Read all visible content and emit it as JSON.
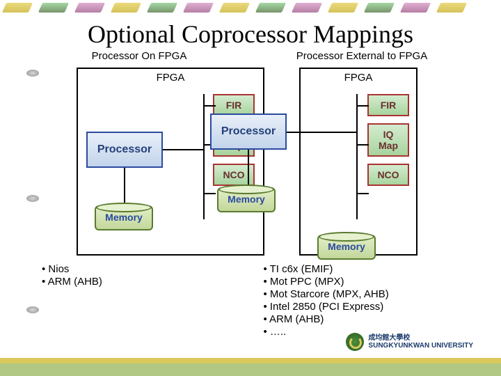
{
  "title": "Optional Coprocessor Mappings",
  "subtitles": {
    "left": "Processor On FPGA",
    "right": "Processor External to FPGA"
  },
  "fpga_label": "FPGA",
  "blocks": {
    "fir": "FIR",
    "iqmap": "IQ\nMap",
    "nco": "NCO",
    "processor": "Processor",
    "memory": "Memory"
  },
  "bullets_left": [
    "• Nios",
    "• ARM (AHB)"
  ],
  "bullets_right": [
    "• TI c6x (EMIF)",
    "• Mot PPC (MPX)",
    "• Mot Starcore (MPX, AHB)",
    "• Intel 2850 (PCI Express)",
    "• ARM (AHB)",
    "• ….."
  ],
  "logo": {
    "line1": "成均館大學校",
    "line2": "SUNGKYUNKWAN UNIVERSITY"
  }
}
